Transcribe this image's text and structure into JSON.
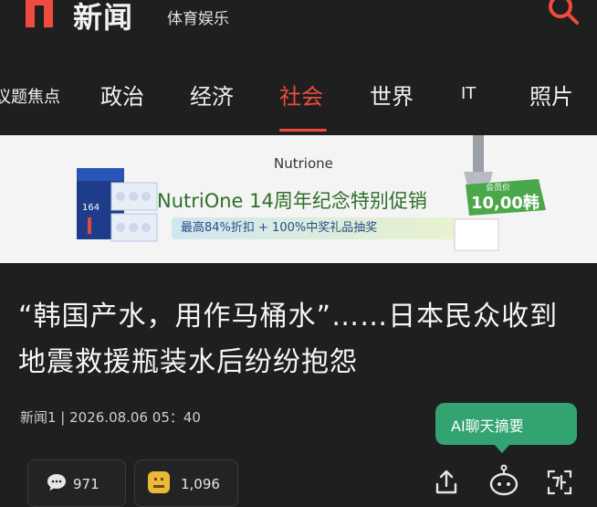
{
  "header": {
    "logo_text": "新闻",
    "section": "体育娱乐",
    "brand_color": "#ef4b3f"
  },
  "nav": {
    "items": [
      {
        "label": "议题焦点",
        "active": false
      },
      {
        "label": "政治",
        "active": false
      },
      {
        "label": "经济",
        "active": false
      },
      {
        "label": "社会",
        "active": true
      },
      {
        "label": "世界",
        "active": false
      },
      {
        "label": "IT",
        "active": false
      },
      {
        "label": "照片",
        "active": false
      }
    ]
  },
  "ad": {
    "brand": "Nutrione",
    "headline": "NutriOne 14周年纪念特别促销",
    "sub": "最高84%折扣 + 100%中奖礼品抽奖",
    "product_label": "164",
    "badge_top": "会员价",
    "badge_text": "10,00韩"
  },
  "article": {
    "title": "“韩国产水，用作马桶水”……日本民众收到地震救援瓶装水后纷纷抱怨",
    "meta": "新闻1 | 2026.08.06 05：40"
  },
  "ai_tooltip": {
    "label": "AI聊天摘要",
    "color": "#32a371"
  },
  "toolbar": {
    "comment_count": "971",
    "reaction_count": "1,096",
    "icons": [
      "comment-icon",
      "reaction-icon",
      "share-icon",
      "ai-bot-icon",
      "translate-icon"
    ]
  }
}
